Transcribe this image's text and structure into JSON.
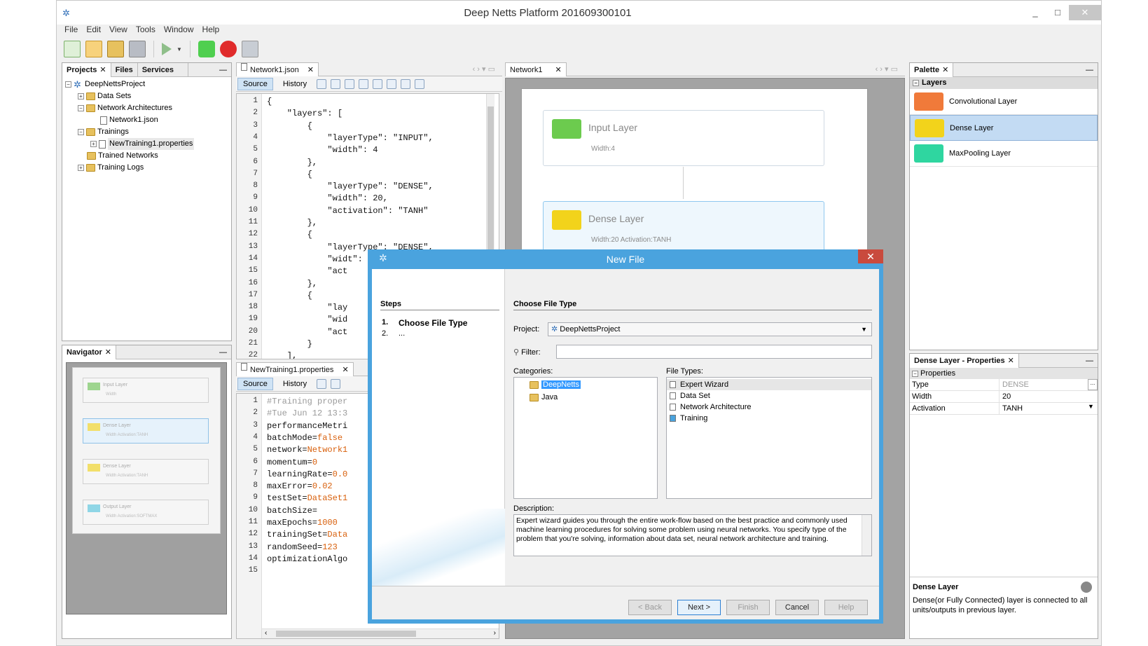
{
  "window": {
    "title": "Deep Netts Platform 201609300101",
    "min": "_",
    "max": "□",
    "close": "✕"
  },
  "menu": [
    "File",
    "Edit",
    "View",
    "Tools",
    "Window",
    "Help"
  ],
  "projects_panel": {
    "tabs": [
      "Projects",
      "Files",
      "Services"
    ],
    "tree": [
      {
        "label": "DeepNettsProject"
      },
      {
        "label": "Data Sets"
      },
      {
        "label": "Network Architectures"
      },
      {
        "label": "Network1.json"
      },
      {
        "label": "Trainings"
      },
      {
        "label": "NewTraining1.properties"
      },
      {
        "label": "Trained Networks"
      },
      {
        "label": "Training Logs"
      }
    ]
  },
  "navigator": {
    "tab": "Navigator",
    "items": [
      "Input Layer",
      "Dense Layer",
      "Dense Layer",
      "Output Layer"
    ],
    "subs": [
      "Width",
      "Width Activation:TANH",
      "Width Activation:TANH",
      "Width Activation:SOFTMAX"
    ]
  },
  "editor1": {
    "tab": "Network1.json",
    "source": "Source",
    "history": "History",
    "lines": [
      "{",
      "    \"layers\": [",
      "        {",
      "            \"layerType\": \"INPUT\",",
      "            \"width\": 4",
      "        },",
      "        {",
      "            \"layerType\": \"DENSE\",",
      "            \"width\": 20,",
      "            \"activation\": \"TANH\"",
      "        },",
      "        {",
      "            \"layerType\": \"DENSE\",",
      "            \"widt\": 6",
      "            \"act",
      "        },",
      "        {",
      "            \"lay",
      "            \"wid",
      "            \"act",
      "        }",
      "    ],"
    ],
    "line_numbers": [
      "1",
      "2",
      "3",
      "4",
      "5",
      "6",
      "7",
      "8",
      "9",
      "10",
      "11",
      "12",
      "13",
      "14",
      "15",
      "16",
      "17",
      "18",
      "19",
      "20",
      "21",
      "22"
    ]
  },
  "editor2": {
    "tab": "NewTraining1.properties",
    "source": "Source",
    "history": "History",
    "lines": [
      [
        "#Training proper",
        ""
      ],
      [
        "#Tue Jun 12 13:3",
        ""
      ],
      [
        "performanceMetri",
        ""
      ],
      [
        "batchMode=",
        "false"
      ],
      [
        "network=",
        "Network1"
      ],
      [
        "momentum=",
        "0"
      ],
      [
        "learningRate=",
        "0.0"
      ],
      [
        "maxError=",
        "0.02"
      ],
      [
        "testSet=",
        "DataSet1"
      ],
      [
        "batchSize=",
        ""
      ],
      [
        "maxEpochs=",
        "1000"
      ],
      [
        "trainingSet=",
        "Data"
      ],
      [
        "randomSeed=",
        "123"
      ],
      [
        "optimizationAlgo",
        ""
      ],
      [
        "",
        ""
      ]
    ],
    "line_numbers": [
      "1",
      "2",
      "3",
      "4",
      "5",
      "6",
      "7",
      "8",
      "9",
      "10",
      "11",
      "12",
      "13",
      "14",
      "15"
    ]
  },
  "canvas": {
    "tab": "Network1",
    "nodes": [
      {
        "title": "Input Layer",
        "sub": "Width:4"
      },
      {
        "title": "Dense Layer",
        "sub": "Width:20    Activation:TANH"
      }
    ]
  },
  "palette": {
    "tab": "Palette",
    "group": "Layers",
    "items": [
      "Convolutional Layer",
      "Dense Layer",
      "MaxPooling Layer"
    ]
  },
  "properties": {
    "tab": "Dense Layer - Properties",
    "group": "Properties",
    "rows": [
      {
        "k": "Type",
        "v": "DENSE"
      },
      {
        "k": "Width",
        "v": "20"
      },
      {
        "k": "Activation",
        "v": "TANH"
      }
    ],
    "help_title": "Dense Layer",
    "help_text": "Dense(or Fully Connected) layer is connected to all units/outputs in previous layer."
  },
  "dialog": {
    "title": "New File",
    "steps_title": "Steps",
    "steps": [
      {
        "n": "1.",
        "t": "Choose File Type"
      },
      {
        "n": "2.",
        "t": "..."
      }
    ],
    "heading": "Choose File Type",
    "project_label": "Project:",
    "project_value": "DeepNettsProject",
    "filter_label": "Filter:",
    "categories_label": "Categories:",
    "categories": [
      "DeepNetts",
      "Java"
    ],
    "filetypes_label": "File Types:",
    "filetypes": [
      "Expert Wizard",
      "Data Set",
      "Network Architecture",
      "Training"
    ],
    "description_label": "Description:",
    "description": "Expert wizard guides you through the entire work-flow based on the best practice and commonly used machine learning procedures for solving some problem using neural networks. You specify type of the problem that you're solving, information about data set, neural network architecture and training.",
    "buttons": {
      "back": "< Back",
      "next": "Next >",
      "finish": "Finish",
      "cancel": "Cancel",
      "help": "Help"
    }
  },
  "colors": {
    "accent": "#4aa3de",
    "input_node": "#5fc24a",
    "dense_node": "#f2d31b",
    "conv": "#f07a3a",
    "maxpool": "#2fd6a0"
  }
}
